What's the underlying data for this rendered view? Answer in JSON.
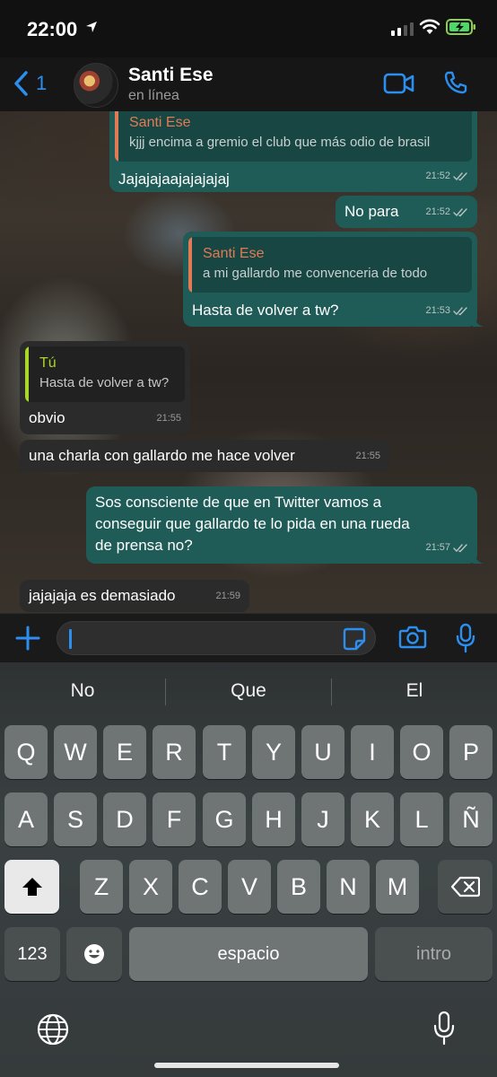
{
  "status_bar": {
    "time": "22:00"
  },
  "header": {
    "back_count": "1",
    "contact_name": "Santi Ese",
    "contact_status": "en línea"
  },
  "messages": [
    {
      "direction": "out",
      "quote_author": "Santi Ese",
      "quote_text": "kjjj encima a gremio el club que más odio de brasil",
      "text": "Jajajajaajajajajaj",
      "time": "21:52"
    },
    {
      "direction": "out",
      "text": "No para",
      "time": "21:52"
    },
    {
      "direction": "out",
      "quote_author": "Santi Ese",
      "quote_text": "a mi gallardo me convenceria de todo",
      "text": "Hasta de volver a tw?",
      "time": "21:53"
    },
    {
      "direction": "in",
      "quote_author": "Tú",
      "quote_text": "Hasta de volver a tw?",
      "text": "obvio",
      "time": "21:55"
    },
    {
      "direction": "in",
      "text": "una charla con gallardo me hace volver",
      "time": "21:55"
    },
    {
      "direction": "out",
      "text_lines": [
        "Sos consciente de que en Twitter vamos a",
        "conseguir que gallardo te lo pida en una rueda",
        "de prensa no?"
      ],
      "time": "21:57"
    },
    {
      "direction": "in",
      "text": "jajajaja es demasiado",
      "time": "21:59"
    }
  ],
  "keyboard": {
    "suggestions": [
      "No",
      "Que",
      "El"
    ],
    "row1": [
      "Q",
      "W",
      "E",
      "R",
      "T",
      "Y",
      "U",
      "I",
      "O",
      "P"
    ],
    "row2": [
      "A",
      "S",
      "D",
      "F",
      "G",
      "H",
      "J",
      "K",
      "L",
      "Ñ"
    ],
    "row3": [
      "Z",
      "X",
      "C",
      "V",
      "B",
      "N",
      "M"
    ],
    "numbers_label": "123",
    "space_label": "espacio",
    "return_label": "intro"
  },
  "colors": {
    "accent": "#2c8ff0",
    "outgoing_bubble": "#1f5b57",
    "incoming_bubble": "#2b2b2b",
    "quote_orange": "#e27a55",
    "quote_green": "#a9d62a"
  },
  "icons": {
    "status": [
      "location-arrow-icon",
      "signal-icon",
      "wifi-icon",
      "battery-charging-icon"
    ],
    "header": [
      "back-chevron-icon",
      "video-call-icon",
      "phone-icon"
    ],
    "input": [
      "plus-icon",
      "sticker-icon",
      "camera-icon",
      "microphone-icon"
    ],
    "keyboard": [
      "shift-icon",
      "backspace-icon",
      "emoji-icon",
      "globe-icon",
      "dictation-icon"
    ]
  }
}
